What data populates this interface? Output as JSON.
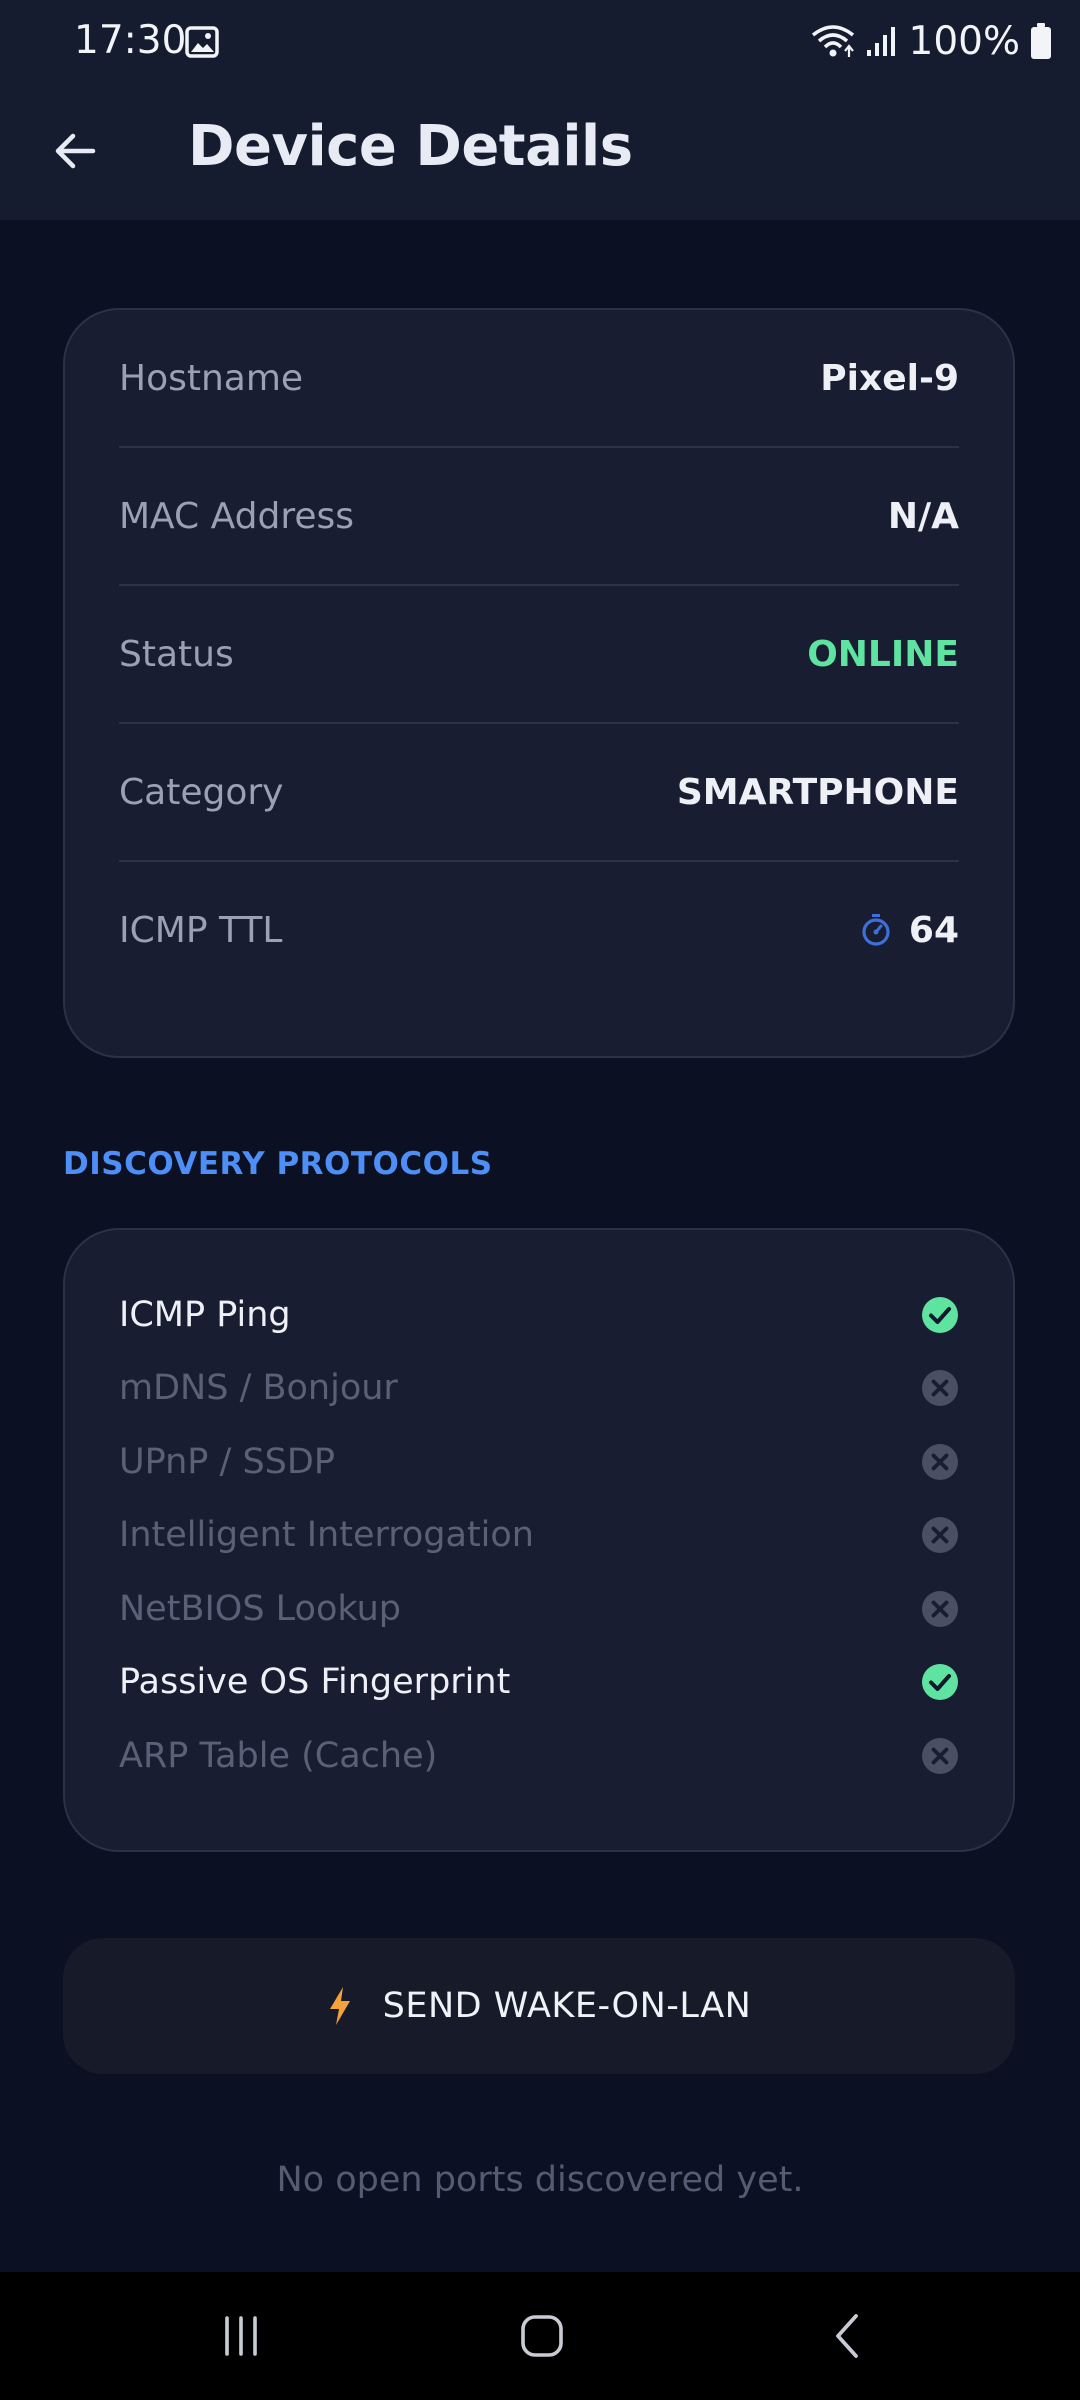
{
  "status_bar": {
    "time": "17:30",
    "battery_percent": "100%",
    "icons": [
      "image-icon",
      "wifi-icon",
      "signal-icon",
      "battery-icon"
    ]
  },
  "app_bar": {
    "title": "Device Details",
    "back_icon": "arrow-left-icon"
  },
  "details": [
    {
      "label": "Hostname",
      "value": "Pixel-9"
    },
    {
      "label": "MAC Address",
      "value": "N/A"
    },
    {
      "label": "Status",
      "value": "ONLINE",
      "color": "#5fe3a1"
    },
    {
      "label": "Category",
      "value": "SMARTPHONE"
    },
    {
      "label": "ICMP TTL",
      "value": "64",
      "icon": "timer-icon"
    }
  ],
  "discovery": {
    "title": "DISCOVERY PROTOCOLS",
    "protocols": [
      {
        "label": "ICMP Ping",
        "found": true
      },
      {
        "label": "mDNS / Bonjour",
        "found": false
      },
      {
        "label": "UPnP / SSDP",
        "found": false
      },
      {
        "label": "Intelligent Interrogation",
        "found": false
      },
      {
        "label": "NetBIOS Lookup",
        "found": false
      },
      {
        "label": "Passive OS Fingerprint",
        "found": true
      },
      {
        "label": "ARP Table (Cache)",
        "found": false
      }
    ]
  },
  "wake_on_lan": {
    "label": "SEND WAKE-ON-LAN",
    "icon": "bolt-icon",
    "icon_color": "#f5a23a"
  },
  "ports": {
    "empty_message": "No open ports discovered yet."
  },
  "colors": {
    "accent": "#4d8ef7",
    "success": "#5fe3a1",
    "background": "#0b1022",
    "card": "#181d31"
  },
  "nav_bar": {
    "icons": [
      "recents-icon",
      "home-icon",
      "back-nav-icon"
    ]
  }
}
